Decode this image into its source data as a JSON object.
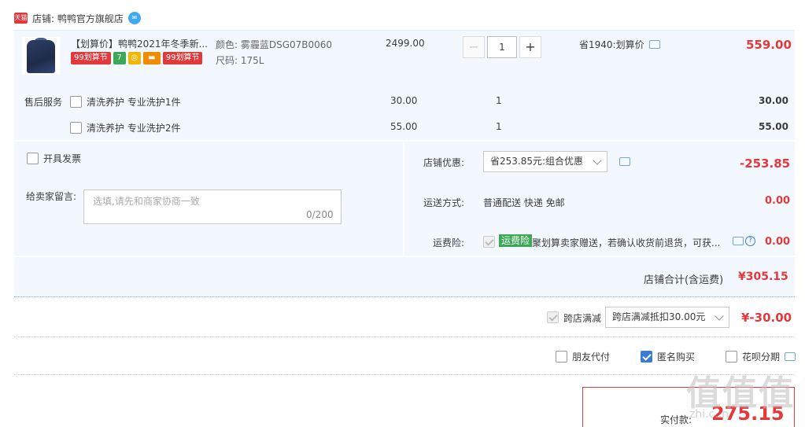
{
  "store": {
    "badge": "天猫",
    "name": "店铺: 鸭鸭官方旗舰店",
    "ww_icon": "ww-chat-icon"
  },
  "item": {
    "title": "【划算价】鸭鸭2021年冬季新...",
    "badges": [
      "99划算节",
      "7",
      "",
      "",
      "99划算节"
    ],
    "color": "颜色: 雾霾蓝DSG07B0060",
    "size": "尺码: 175L",
    "unit_price": "2499.00",
    "qty": "1",
    "qty_minus": "−",
    "qty_plus": "+",
    "promo": "省1940:划算价",
    "total": "559.00"
  },
  "service": {
    "label": "售后服务",
    "rows": [
      {
        "name": "清洗养护 专业洗护1件",
        "price": "30.00",
        "qty": "1",
        "total": "30.00"
      },
      {
        "name": "清洗养护 专业洗护2件",
        "price": "55.00",
        "qty": "1",
        "total": "55.00"
      }
    ]
  },
  "invoice": {
    "label": "开具发票"
  },
  "message": {
    "label": "给卖家留言:",
    "placeholder": "选填,请先和商家协商一致",
    "count": "0/200"
  },
  "coupon": {
    "label": "店铺优惠:",
    "selected": "省253.85元:组合优惠",
    "value": "-253.85"
  },
  "shipping": {
    "label": "运送方式:",
    "method": "普通配送 快递 免邮",
    "cost": "0.00"
  },
  "insurance": {
    "label": "运费险:",
    "tag": "运费险",
    "text": "聚划算卖家赠送，若确认收货前退货，可获...",
    "cost": "0.00"
  },
  "subtotal": {
    "label": "店铺合计(含运费)",
    "value": "¥305.15"
  },
  "cross_store": {
    "label": "跨店满减",
    "selected": "跨店满减抵扣30.00元",
    "value": "¥-30.00"
  },
  "options": {
    "friend_pay": "朋友代付",
    "anonymous": "匿名购买",
    "huabei": "花呗分期"
  },
  "payment": {
    "label": "实付款:",
    "value": "275.15"
  },
  "watermark": {
    "text": "值值值",
    "url": "zhi.c..n"
  },
  "colors": {
    "accent": "#e4393c",
    "panel": "#f3f8fe",
    "link": "#3a7bd5"
  }
}
